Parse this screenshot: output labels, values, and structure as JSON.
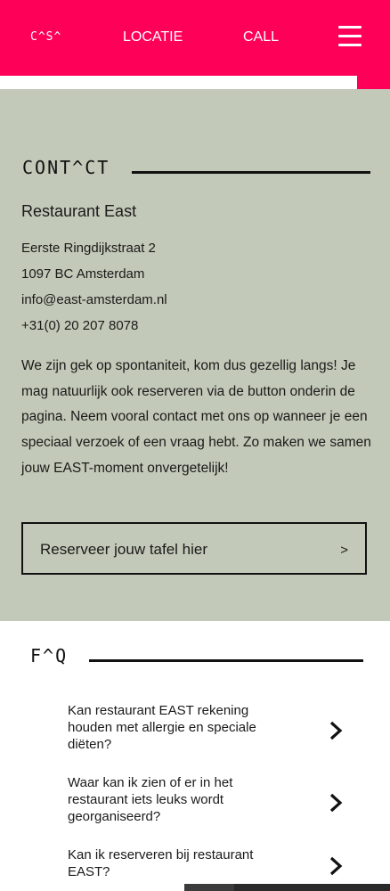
{
  "nav": {
    "logo": "C^S^",
    "locatie": "LOCATIE",
    "call": "CALL",
    "menu_icon": "hamburger-icon",
    "toggle_icon": "contrast-toggle-icon",
    "accent_color": "#ff0059"
  },
  "contact": {
    "heading": "CONT^CT",
    "background_color": "#c3c9b8",
    "restaurant_name": "Restaurant East",
    "address_line1": "Eerste Ringdijkstraat 2",
    "address_line2": "1097 BC Amsterdam",
    "email": "info@east-amsterdam.nl",
    "phone": "+31(0) 20 207 8078",
    "description": "We zijn gek op spontaniteit, kom dus gezellig langs! Je mag natuurlijk ook reserveren via de button onderin de pagina. Neem vooral contact met ons op wanneer je een speciaal verzoek of een vraag hebt. Zo maken we samen jouw EAST-moment onvergetelijk!",
    "reserve_button": "Reserveer jouw tafel hier",
    "reserve_arrow": ">"
  },
  "faq": {
    "heading": "F^Q",
    "chevron_icon": "chevron-right-icon",
    "items": [
      {
        "question": "Kan restaurant EAST rekening houden met allergie en speciale diëten?"
      },
      {
        "question": "Waar kan ik zien of er in het restaurant iets leuks wordt georganiseerd?"
      },
      {
        "question": "Kan ik reserveren bij restaurant EAST?"
      }
    ]
  }
}
